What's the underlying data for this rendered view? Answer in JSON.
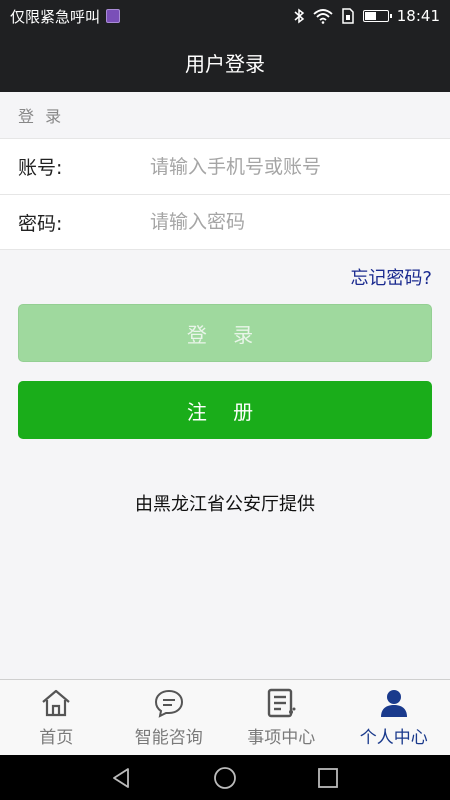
{
  "status_bar": {
    "left_text": "仅限紧急呼叫",
    "time": "18:41",
    "battery_level": 0.55
  },
  "header": {
    "title": "用户登录"
  },
  "section_label": "登 录",
  "form": {
    "account_label": "账号:",
    "account_placeholder": "请输入手机号或账号",
    "password_label": "密码:",
    "password_placeholder": "请输入密码"
  },
  "forgot_password": "忘记密码?",
  "buttons": {
    "login": "登 录",
    "register": "注 册"
  },
  "provider_text": "由黑龙江省公安厅提供",
  "tabs": [
    {
      "label": "首页",
      "icon": "home-icon",
      "active": false
    },
    {
      "label": "智能咨询",
      "icon": "chat-bubble-icon",
      "active": false
    },
    {
      "label": "事项中心",
      "icon": "list-document-icon",
      "active": false
    },
    {
      "label": "个人中心",
      "icon": "person-icon",
      "active": true
    }
  ],
  "colors": {
    "header_bg": "#1f2022",
    "primary_green": "#1aad1a",
    "disabled_green": "#9fd99e",
    "link_blue": "#1a2a8f",
    "active_tab": "#1a3a8c"
  }
}
